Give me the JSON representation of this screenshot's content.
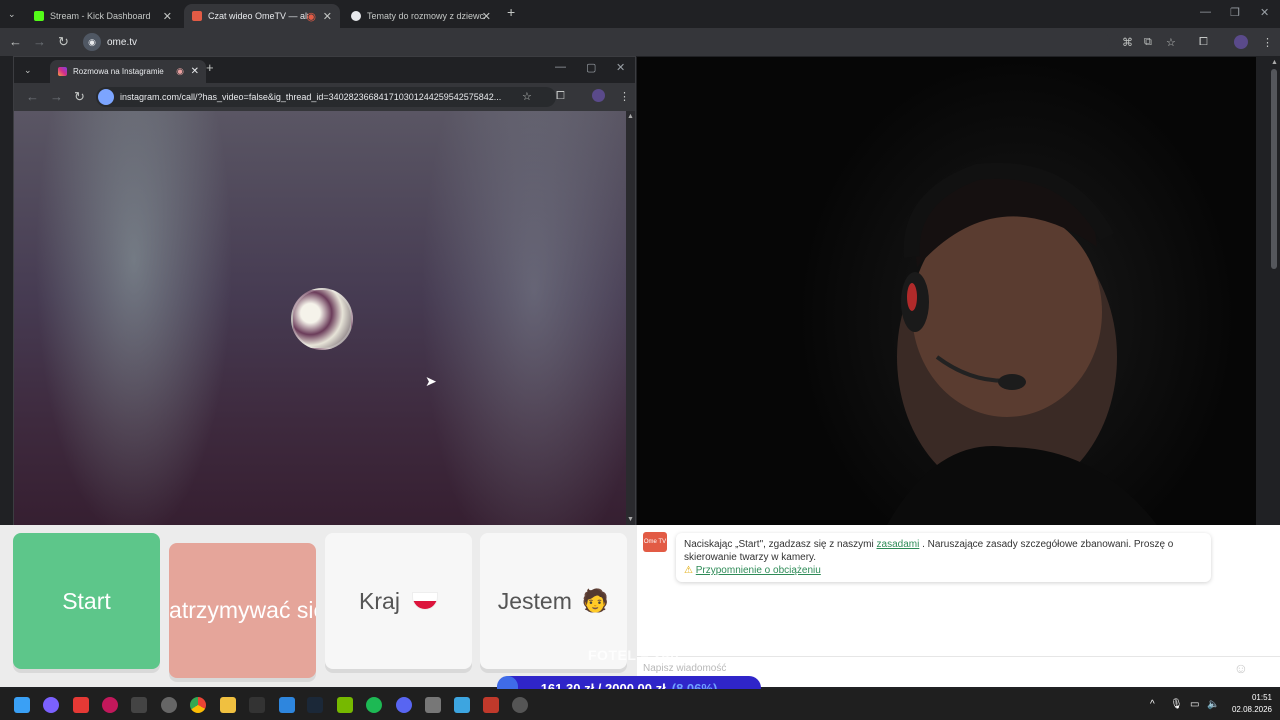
{
  "browser": {
    "tabs": [
      {
        "title": "Stream - Kick Dashboard",
        "favicon_color": "#53fc18"
      },
      {
        "title": "Czat wideo OmeTV — alter",
        "favicon_color": "#e25b45"
      },
      {
        "title": "Tematy do rozmowy z dziewczy",
        "favicon_color": "#e8eaed"
      }
    ],
    "new_tab": "+",
    "url": "ome.tv"
  },
  "popup": {
    "tab_title": "Rozmowa na Instagramie",
    "new_tab": "+",
    "url": "instagram.com/call/?has_video=false&ig_thread_id=340282366841710301244259542575842..."
  },
  "ome": {
    "buttons": {
      "start": "Start",
      "stop": "Zatrzymywać się",
      "country": "Kraj",
      "gender": "Jestem"
    },
    "colors": {
      "start": "#5dc68a",
      "stop": "#e5a59a",
      "neutral": "#f7f7f7"
    },
    "logo_text": "Ome TV",
    "notice_prefix": "Naciskając „Start\", zgadzasz się z naszymi",
    "notice_link": "zasadami",
    "notice_suffix": ". Naruszające zasady szczegółowe zbanowani. Proszę o skierowanie twarzy w kamery.",
    "warning_link": "Przypomnienie o obciążeniu",
    "input_placeholder": "Napisz wiadomość"
  },
  "overlay": {
    "fotel": "FOTEL = 24h",
    "goal": "161,30 zł / 2000,00 zł",
    "goal_pct": "(8,06%)",
    "goal_fraction": 0.0806
  },
  "taskbar": {
    "time": "01:51",
    "date": "02.08.2026"
  }
}
